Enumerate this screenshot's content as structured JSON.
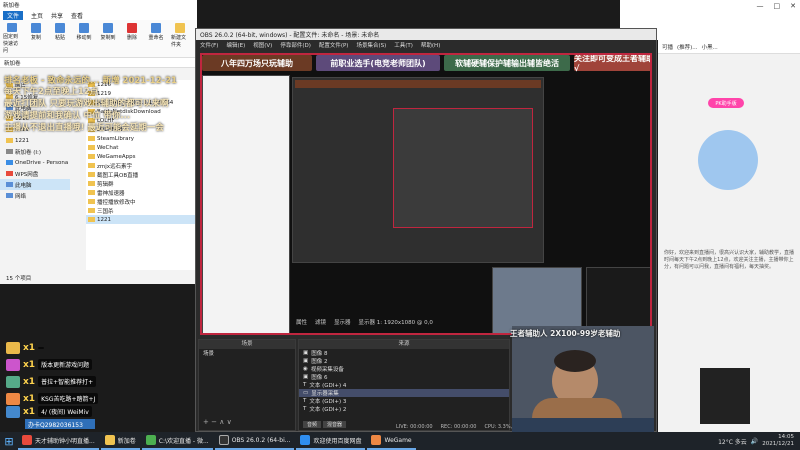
{
  "explorer": {
    "title": "新加卷",
    "tabs": [
      "文件",
      "主页",
      "共享",
      "查看"
    ],
    "ribbon": [
      "固定到快速访问",
      "复制",
      "粘贴",
      "移动到",
      "复制到",
      "删除",
      "重命名",
      "新建文件夹"
    ],
    "nav_items": [
      {
        "icon": "folder-icon",
        "label": "图片"
      },
      {
        "icon": "folder-icon",
        "label": "6.15修复"
      },
      {
        "icon": "folder-icon",
        "label": "此电脑"
      },
      {
        "icon": "folder-icon",
        "label": "1216"
      },
      {
        "icon": "folder-icon",
        "label": "1219"
      },
      {
        "icon": "folder-icon",
        "label": "1221"
      },
      {
        "icon": "drive-icon",
        "label": "新加卷 (I:)"
      },
      {
        "icon": "cloud-icon",
        "label": "OneDrive - Persona"
      },
      {
        "icon": "cloud-icon",
        "label": "WPS网盘"
      },
      {
        "icon": "pc-icon",
        "label": "此电脑"
      },
      {
        "icon": "network-icon",
        "label": "网络"
      }
    ],
    "files": [
      "1216",
      "1219",
      "ARCTIME_PRO_3.1.1_WIN64",
      "BaiduNetdiskDownload",
      "LOLHF",
      "LOLHFOB",
      "SteamLibrary",
      "WeChat",
      "WeGameApps",
      "zmjx远石素宇",
      "截图工具OB直播",
      "剪辑群",
      "雷神加速器",
      "播控播放修改中",
      "三国杀",
      "1221"
    ],
    "status": "15 个项目"
  },
  "obs": {
    "title": "OBS 26.0.2 (64-bit, windows) - 配置文件: 未命名 - 场景: 未命名",
    "menu": [
      "文件(F)",
      "编辑(E)",
      "视图(V)",
      "停靠部件(D)",
      "配置文件(P)",
      "场景集合(S)",
      "工具(T)",
      "帮助(H)"
    ],
    "banners": [
      "八年四万场只玩辅助",
      "前职业选手(电竞老师团队)",
      "软辅硬辅保护辅输出辅皆绝活",
      "关注即可变成王者辅助√"
    ],
    "toolbar": [
      "属性",
      "滤镜",
      "显示器",
      "显示器 1: 1920x1080 @ 0,0"
    ],
    "scenes_header": "场景",
    "scenes": [
      "场景"
    ],
    "sources_header": "来源",
    "sources": [
      {
        "icon": "image-icon",
        "label": "图像 8",
        "selected": false
      },
      {
        "icon": "image-icon",
        "label": "图像 2",
        "selected": false
      },
      {
        "icon": "camera-icon",
        "label": "视频采集设备",
        "selected": false
      },
      {
        "icon": "image-icon",
        "label": "图像 6",
        "selected": false
      },
      {
        "icon": "text-icon",
        "label": "文本 (GDI+) 4",
        "selected": false
      },
      {
        "icon": "monitor-icon",
        "label": "显示器采集",
        "selected": true
      },
      {
        "icon": "text-icon",
        "label": "文本 (GDI+) 3",
        "selected": false
      },
      {
        "icon": "text-icon",
        "label": "文本 (GDI+) 2",
        "selected": false
      }
    ],
    "audio_tabs": [
      "音频",
      "混音器"
    ],
    "status": [
      "LIVE: 00:00:00",
      "REC: 00:00:00",
      "CPU: 3.3%, 30.00 fps"
    ]
  },
  "overlay_lines": [
    "排名老板 - 致命永远的... 新增 2021-12-21",
    "每天下午2点至晚上12点",
    "最近打团队 只要玩游戏出辅助的都可以来啊",
    "游戏请提前和我确认 中位 带你...",
    "主播从不退出直播哦! 最近可能会延期一会"
  ],
  "gifts": [
    {
      "count": "x1",
      "text": ""
    },
    {
      "count": "x1",
      "text": "版本更新游戏问题"
    },
    {
      "count": "x1",
      "text": "普拉+智能推荐打+"
    },
    {
      "count": "x1",
      "text": "KSG苦吃路+踏箭+J"
    },
    {
      "count": "x1",
      "text": "4/ (夜间) WeiMiv"
    }
  ],
  "qq": "办卡Q2982036153",
  "cam_caption": "王者辅助人 2X100-99岁老辅助",
  "browser": {
    "tabs": [
      "可播",
      "(推荐)...",
      "小黑..."
    ],
    "badge": "PK助手版",
    "text": "你好，欢迎来到直播间，很高兴认识大家，辅助教学，直播时间每天下午2点到晚上12点，欢迎关注主播，主播带你上分，有问题可以问我，直播间有福利，每天抽奖。"
  },
  "taskbar": {
    "items": [
      "天才辅助钟小明直播...",
      "新加卷",
      "C:\\欢迎直播 - 微...",
      "OBS 26.0.2 (64-bi...",
      "欢迎使用百度网盘",
      "WeGame"
    ],
    "weather": "12°C 多云",
    "time": "14:05",
    "date": "2021/12/21"
  }
}
